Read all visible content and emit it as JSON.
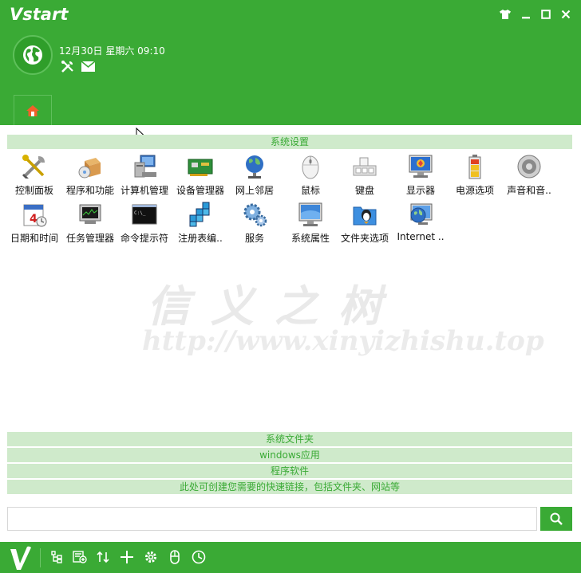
{
  "app": {
    "logo_text": "Vstart"
  },
  "header": {
    "datetime": "12月30日 星期六 09:10"
  },
  "groups": {
    "system_settings": "系统设置",
    "system_folders": "系统文件夹",
    "windows_apps": "windows应用",
    "programs": "程序软件",
    "quick_links_hint": "此处可创建您需要的快速链接，包括文件夹、网站等"
  },
  "items": [
    {
      "label": "控制面板",
      "icon": "control-panel-icon"
    },
    {
      "label": "程序和功能",
      "icon": "programs-features-icon"
    },
    {
      "label": "计算机管理",
      "icon": "computer-management-icon"
    },
    {
      "label": "设备管理器",
      "icon": "device-manager-icon"
    },
    {
      "label": "网上邻居",
      "icon": "network-globe-icon"
    },
    {
      "label": "鼠标",
      "icon": "mouse-icon"
    },
    {
      "label": "键盘",
      "icon": "keyboard-icon"
    },
    {
      "label": "显示器",
      "icon": "monitor-icon"
    },
    {
      "label": "电源选项",
      "icon": "battery-icon"
    },
    {
      "label": "声音和音..",
      "icon": "speaker-icon"
    },
    {
      "label": "日期和时间",
      "icon": "calendar-icon"
    },
    {
      "label": "任务管理器",
      "icon": "task-manager-icon"
    },
    {
      "label": "命令提示符",
      "icon": "command-prompt-icon"
    },
    {
      "label": "注册表编..",
      "icon": "registry-editor-icon"
    },
    {
      "label": "服务",
      "icon": "services-gear-icon"
    },
    {
      "label": "系统属性",
      "icon": "system-properties-icon"
    },
    {
      "label": "文件夹选项",
      "icon": "folder-options-icon"
    },
    {
      "label": "Internet ..",
      "icon": "internet-options-icon"
    }
  ],
  "watermark": {
    "line1": "信义之树",
    "line2": "http://www.xinyizhishu.top"
  },
  "search": {
    "value": "",
    "placeholder": ""
  },
  "colors": {
    "brand_green": "#3aaa35",
    "group_bg": "#cfeacb"
  }
}
